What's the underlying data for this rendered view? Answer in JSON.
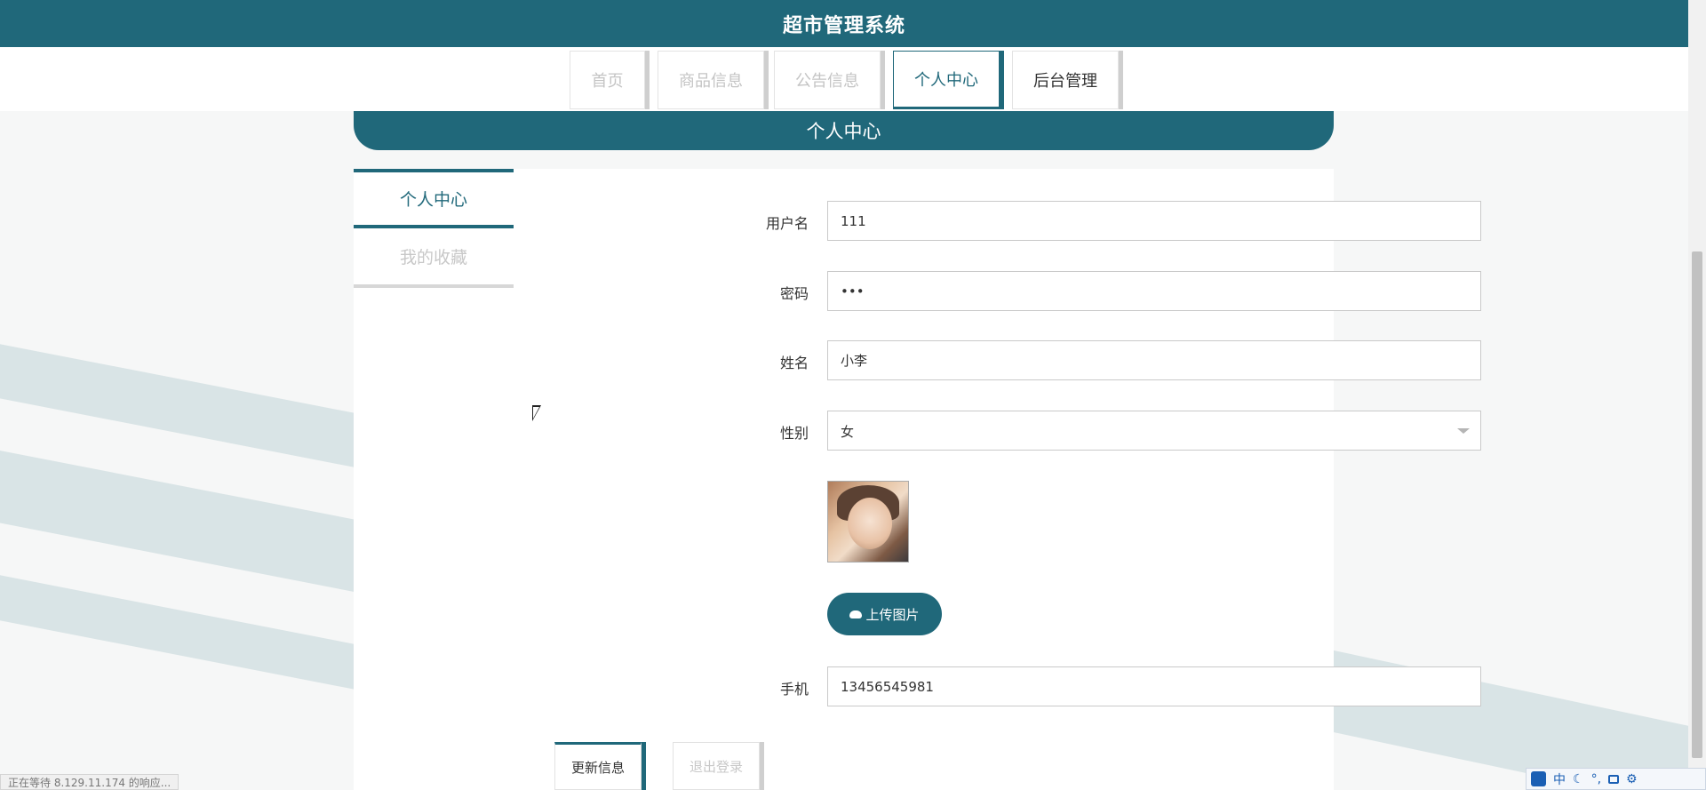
{
  "app": {
    "title": "超市管理系统"
  },
  "nav": {
    "items": [
      {
        "label": "首页"
      },
      {
        "label": "商品信息"
      },
      {
        "label": "公告信息"
      },
      {
        "label": "个人中心"
      },
      {
        "label": "后台管理"
      }
    ],
    "active": "个人中心"
  },
  "panel": {
    "title": "个人中心"
  },
  "sidemenu": {
    "items": [
      {
        "label": "个人中心"
      },
      {
        "label": "我的收藏"
      }
    ],
    "active": "个人中心"
  },
  "form": {
    "username": {
      "label": "用户名",
      "value": "111"
    },
    "password": {
      "label": "密码",
      "value": "•••"
    },
    "name": {
      "label": "姓名",
      "value": "小李"
    },
    "gender": {
      "label": "性别",
      "value": "女"
    },
    "upload_label": "上传图片",
    "phone": {
      "label": "手机",
      "value": "13456545981"
    }
  },
  "actions": {
    "update_label": "更新信息",
    "logout_label": "退出登录"
  },
  "statusbar": {
    "text": "正在等待 8.129.11.174 的响应..."
  },
  "ime": {
    "mode": "中"
  },
  "colors": {
    "accent": "#20687a",
    "inactive_text": "#c4c4c4"
  }
}
